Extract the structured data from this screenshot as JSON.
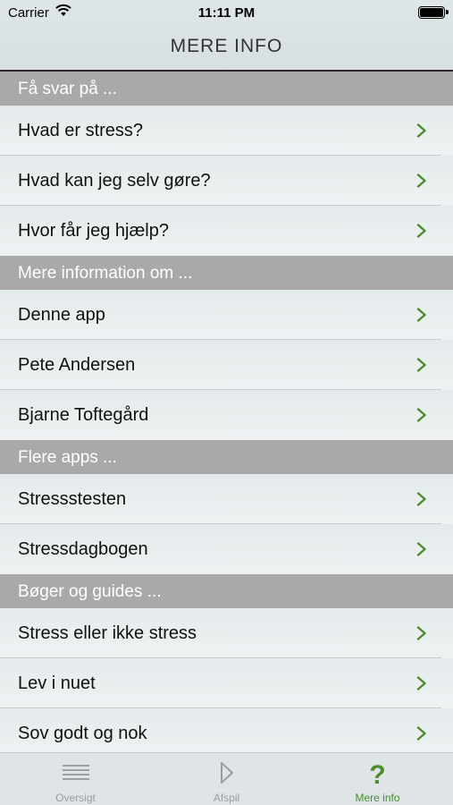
{
  "status": {
    "carrier": "Carrier",
    "time": "11:11 PM"
  },
  "nav": {
    "title": "MERE INFO"
  },
  "sections": [
    {
      "header": "Få svar på ...",
      "rows": [
        "Hvad er stress?",
        "Hvad kan jeg selv gøre?",
        "Hvor får jeg hjælp?"
      ]
    },
    {
      "header": "Mere information om ...",
      "rows": [
        "Denne app",
        "Pete Andersen",
        "Bjarne Toftegård"
      ]
    },
    {
      "header": "Flere apps ...",
      "rows": [
        "Stressstesten",
        "Stressdagbogen"
      ]
    },
    {
      "header": "Bøger og guides ...",
      "rows": [
        "Stress eller ikke stress",
        "Lev i nuet",
        "Sov godt og nok"
      ]
    }
  ],
  "tabs": [
    {
      "label": "Oversigt",
      "icon": "list-lines-icon",
      "active": false
    },
    {
      "label": "Afspil",
      "icon": "play-icon",
      "active": false
    },
    {
      "label": "Mere info",
      "icon": "question-mark-icon",
      "active": true
    }
  ],
  "colors": {
    "accent": "#4a8e2e",
    "section_header": "#a9a9a9",
    "inactive_tab": "#9aa0a2"
  }
}
